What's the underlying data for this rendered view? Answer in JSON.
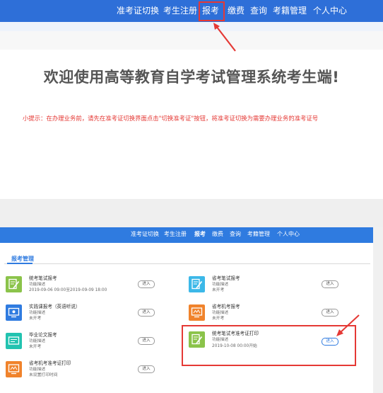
{
  "top_nav": {
    "items": [
      {
        "label": "准考证切换"
      },
      {
        "label": "考生注册"
      },
      {
        "label": "报考"
      },
      {
        "label": "缴费"
      },
      {
        "label": "查询"
      },
      {
        "label": "考籍管理"
      },
      {
        "label": "个人中心"
      }
    ],
    "highlighted": "报考"
  },
  "welcome_title": "欢迎使用高等教育自学考试管理系统考生端!",
  "tip_text": "小提示：在办理业务前，请先在准考证切换界面点击\"切换准考证\"按钮，将准考证切换为需要办理业务的准考证号",
  "nav2": {
    "items": [
      {
        "label": "准考证切换"
      },
      {
        "label": "考生注册"
      },
      {
        "label": "报考"
      },
      {
        "label": "缴费"
      },
      {
        "label": "查询"
      },
      {
        "label": "考籍管理"
      },
      {
        "label": "个人中心"
      }
    ],
    "active": "报考"
  },
  "tab_label": "报考管理",
  "cards": [
    {
      "title": "统考笔试报考",
      "desc": "功能描述",
      "status": "2019-09-06 09:00至2019-09-09 18:00",
      "button": "进入",
      "icon": "edit-form-icon",
      "color": "#8bc34a"
    },
    {
      "title": "省考笔试报考",
      "desc": "功能描述",
      "status": "未开考",
      "button": "进入",
      "icon": "edit-form-icon",
      "color": "#3cb8e8"
    },
    {
      "title": "实践课报考（英语听说）",
      "desc": "功能描述",
      "status": "未开考",
      "button": "进入",
      "icon": "monitor-icon",
      "color": "#2f7be0"
    },
    {
      "title": "省考机考报考",
      "desc": "功能描述",
      "status": "未开考",
      "button": "进入",
      "icon": "screen-icon",
      "color": "#f0832c"
    },
    {
      "title": "毕业论文报考",
      "desc": "功能描述",
      "status": "未开考",
      "button": "进入",
      "icon": "paper-icon",
      "color": "#22c3b0"
    },
    {
      "title": "统考笔试考准考证打印",
      "desc": "功能描述",
      "status": "2019-10-08 00:00开始",
      "button": "进入",
      "icon": "edit-form-icon",
      "color": "#8bc34a"
    },
    {
      "title": "省考机考准考证打印",
      "desc": "功能描述",
      "status": "未设置打印时间",
      "button": "进入",
      "icon": "screen-icon",
      "color": "#f0832c"
    }
  ],
  "colors": {
    "nav": "#2e6fd8",
    "annotation": "#e53935",
    "tip": "#e53935",
    "tab": "#2f7be0"
  }
}
